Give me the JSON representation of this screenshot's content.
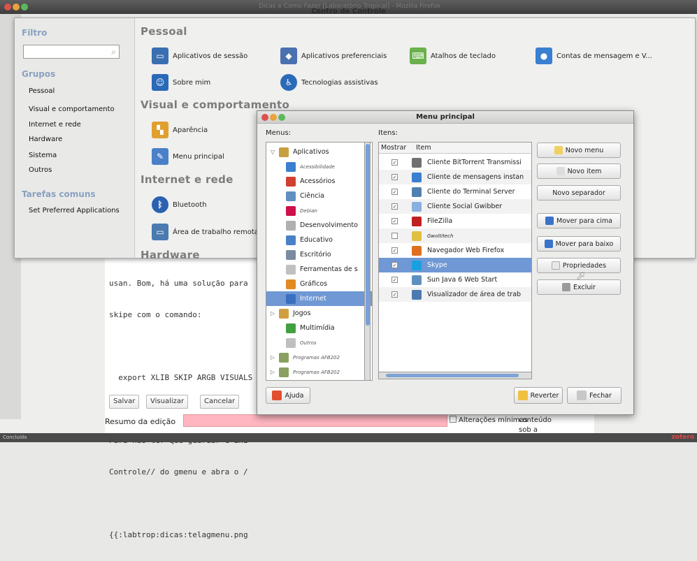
{
  "browser": {
    "title": "Dicas e Como Fazer [Laboratório Tropical] - Mozilla Firefox",
    "editor_lines": [
      "usan. Bom, há uma solução para",
      "skipe com o comando:",
      "",
      "  export XLIB SKIP ARGB VISUALS",
      "",
      "Para não ter que guardar e ini",
      "Controle// do gmenu e abra o /",
      "",
      "{{:labtrop:dicas:telagmenu.png"
    ],
    "buttons": {
      "save": "Salvar",
      "preview": "Visualizar",
      "cancel": "Cancelar"
    },
    "summary_label": "Resumo da edição",
    "minor_edit_label": "Alterações mínimas",
    "license_text": "conteúdo sob a",
    "status_text": "Concluído",
    "zotero_label": "zotero"
  },
  "control_center": {
    "title": "Centro de Controle",
    "filter_label": "Filtro",
    "groups_label": "Grupos",
    "groups": [
      "Pessoal",
      "Visual e comportamento",
      "Internet e rede",
      "Hardware",
      "Sistema",
      "Outros"
    ],
    "tasks_label": "Tarefas comuns",
    "tasks": [
      "Set Preferred Applications"
    ],
    "sections": {
      "personal": "Pessoal",
      "look": "Visual e comportamento",
      "internet": "Internet e rede",
      "hardware": "Hardware"
    },
    "personal_items": [
      "Aplicativos de sessão",
      "Aplicativos preferenciais",
      "Atalhos de teclado",
      "Contas de mensagem e V...",
      "Sobre mim",
      "Tecnologias assistivas"
    ],
    "look_items": [
      "Aparência",
      "Menu principal"
    ],
    "internet_items": [
      "Bluetooth",
      "Área de trabalho remota"
    ]
  },
  "menu_dialog": {
    "title": "Menu principal",
    "menus_label": "Menus:",
    "items_label": "Itens:",
    "col_show": "Mostrar",
    "col_item": "Item",
    "menus": [
      {
        "label": "Aplicativos",
        "expander": "▽",
        "indent": 0,
        "small": false,
        "color": "#c8a040"
      },
      {
        "label": "Acessibilidade",
        "expander": "",
        "indent": 1,
        "small": true,
        "color": "#3a7fd0"
      },
      {
        "label": "Acessórios",
        "expander": "",
        "indent": 1,
        "small": false,
        "color": "#d04030"
      },
      {
        "label": "Ciência",
        "expander": "",
        "indent": 1,
        "small": false,
        "color": "#6090c0"
      },
      {
        "label": "Debian",
        "expander": "",
        "indent": 1,
        "small": true,
        "color": "#d0104a"
      },
      {
        "label": "Desenvolvimento",
        "expander": "",
        "indent": 1,
        "small": false,
        "color": "#b0b0b0"
      },
      {
        "label": "Educativo",
        "expander": "",
        "indent": 1,
        "small": false,
        "color": "#4a80c8"
      },
      {
        "label": "Escritório",
        "expander": "",
        "indent": 1,
        "small": false,
        "color": "#7a8aa0"
      },
      {
        "label": "Ferramentas de s",
        "expander": "",
        "indent": 1,
        "small": false,
        "color": "#c0c0c0"
      },
      {
        "label": "Gráficos",
        "expander": "",
        "indent": 1,
        "small": false,
        "color": "#e08a20"
      },
      {
        "label": "Internet",
        "expander": "",
        "indent": 1,
        "small": false,
        "color": "#3a70c0",
        "selected": true
      },
      {
        "label": "Jogos",
        "expander": "▷",
        "indent": 0,
        "small": false,
        "color": "#d0a040"
      },
      {
        "label": "Multimídia",
        "expander": "",
        "indent": 1,
        "small": false,
        "color": "#40a040"
      },
      {
        "label": "Outros",
        "expander": "",
        "indent": 1,
        "small": true,
        "color": "#c0c0c0"
      },
      {
        "label": "Programas AFB202",
        "expander": "▷",
        "indent": 0,
        "small": true,
        "color": "#8aa060"
      },
      {
        "label": "Programas AFB202",
        "expander": "▷",
        "indent": 0,
        "small": true,
        "color": "#8aa060"
      }
    ],
    "items": [
      {
        "checked": true,
        "label": "Cliente BitTorrent Transmissi",
        "small": false,
        "color": "#707070"
      },
      {
        "checked": true,
        "label": "Cliente de mensagens instan",
        "small": false,
        "color": "#3a7fd0"
      },
      {
        "checked": true,
        "label": "Cliente do Terminal Server",
        "small": false,
        "color": "#5080b0"
      },
      {
        "checked": true,
        "label": "Cliente Social Gwibber",
        "small": false,
        "color": "#8ab0e0"
      },
      {
        "checked": true,
        "label": "FileZilla",
        "small": false,
        "color": "#c02020"
      },
      {
        "checked": false,
        "label": "Gwoltitech",
        "small": true,
        "color": "#e0c040"
      },
      {
        "checked": true,
        "label": "Navegador Web Firefox",
        "small": false,
        "color": "#e07020"
      },
      {
        "checked": true,
        "label": "Skype",
        "small": false,
        "color": "#1aa0e0",
        "selected": true
      },
      {
        "checked": true,
        "label": "Sun Java 6 Web Start",
        "small": false,
        "color": "#6090c0"
      },
      {
        "checked": true,
        "label": "Visualizador de área de trab",
        "small": false,
        "color": "#4a7ab0"
      }
    ],
    "buttons": {
      "new_menu": "Novo menu",
      "new_item": "Novo item",
      "new_separator": "Novo separador",
      "move_up": "Mover para cima",
      "move_down": "Mover para baixo",
      "properties": "Propriedades",
      "delete": "Excluir",
      "help": "Ajuda",
      "revert": "Reverter",
      "close": "Fechar"
    }
  },
  "colors": {
    "selection": "#6f98d4",
    "section_header": "#7c7c7c",
    "side_header": "#8aa1c0"
  }
}
